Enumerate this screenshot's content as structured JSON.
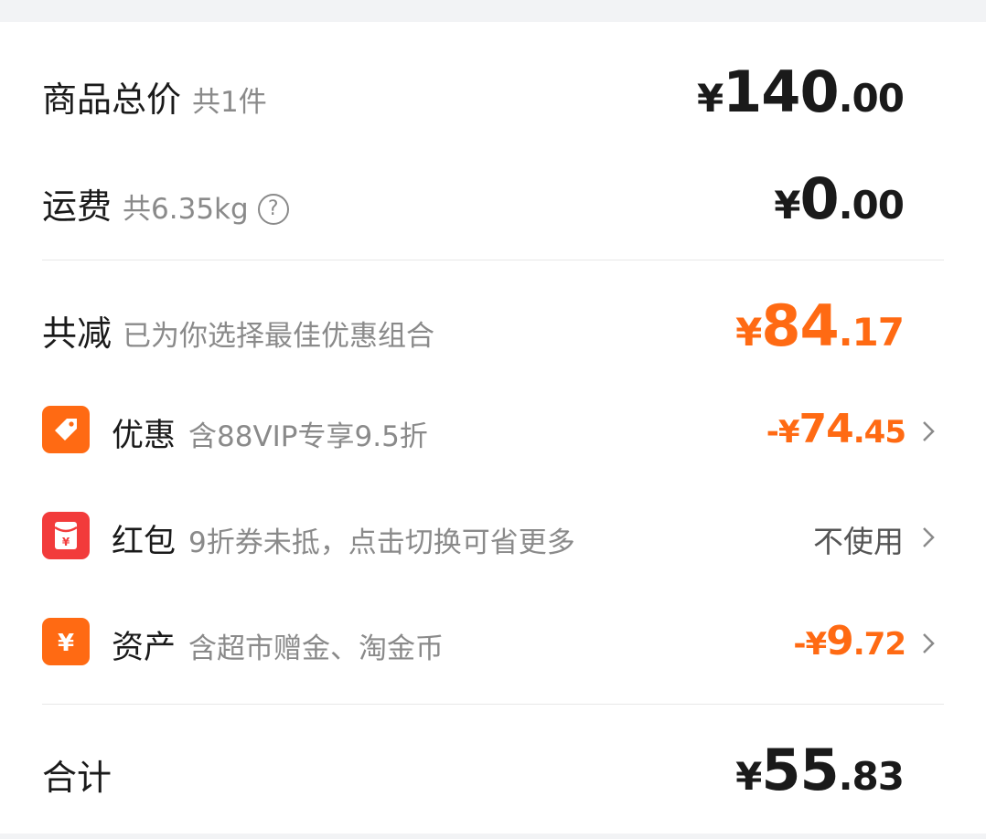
{
  "goods_total": {
    "label": "商品总价",
    "sub": "共1件",
    "yen": "¥",
    "int": "140",
    "dec": ".00"
  },
  "shipping": {
    "label": "运费",
    "sub": "共6.35kg",
    "help_icon": "question-circle-icon",
    "help_glyph": "?",
    "yen": "¥",
    "int": "0",
    "dec": ".00"
  },
  "discount_total": {
    "label": "共减",
    "sub": "已为你选择最佳优惠组合",
    "yen": "¥",
    "int": "84",
    "dec": ".17"
  },
  "items": [
    {
      "icon": "tag-icon",
      "label": "优惠",
      "sub": "含88VIP专享9.5折",
      "prefix": "-¥",
      "int": "74",
      "dec": ".45"
    },
    {
      "icon": "red-packet-icon",
      "label": "红包",
      "sub": "9折券未抵，点击切换可省更多",
      "text": "不使用"
    },
    {
      "icon": "yen-asset-icon",
      "label": "资产",
      "sub": "含超市赠金、淘金币",
      "prefix": "-¥",
      "int": "9",
      "dec": ".72"
    }
  ],
  "total": {
    "label": "合计",
    "yen": "¥",
    "int": "55",
    "dec": ".83"
  },
  "colors": {
    "accent": "#ff6a13",
    "red": "#f23b3b",
    "text": "#1a1a1a",
    "muted": "#8a8a8a"
  }
}
